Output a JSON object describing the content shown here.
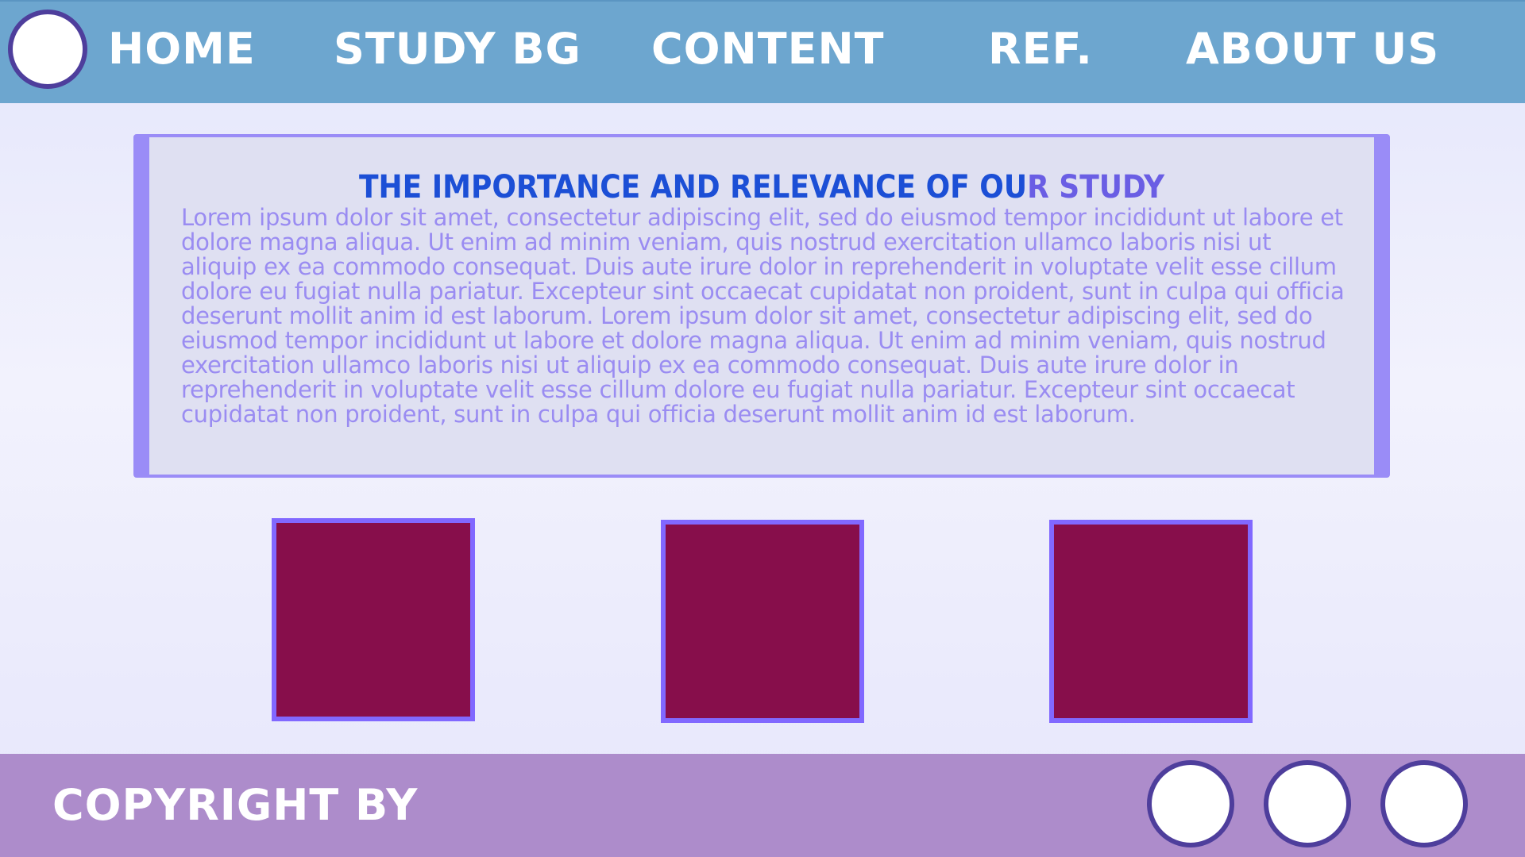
{
  "nav": {
    "items": [
      {
        "label": "HOME"
      },
      {
        "label": "STUDY BG"
      },
      {
        "label": "CONTENT"
      },
      {
        "label": "REF."
      },
      {
        "label": "ABOUT US"
      }
    ]
  },
  "main": {
    "title_part1": "THE IMPORTANCE AND RELEVANCE OF OU",
    "title_part2": "R STUDY",
    "body": "Lorem ipsum dolor sit amet, consectetur adipiscing elit, sed do eiusmod tempor incididunt ut labore et dolore magna aliqua. Ut enim ad minim veniam, quis nostrud exercitation ullamco laboris nisi ut aliquip ex ea commodo consequat. Duis aute irure dolor in reprehenderit in voluptate velit esse cillum dolore eu fugiat nulla pariatur. Excepteur sint occaecat cupidatat non proident, sunt in culpa qui officia deserunt mollit anim id est laborum. Lorem ipsum dolor sit amet, consectetur adipiscing elit, sed do eiusmod tempor incididunt ut labore et dolore magna aliqua. Ut enim ad minim veniam, quis nostrud exercitation ullamco laboris nisi ut aliquip ex ea commodo consequat. Duis aute irure dolor in reprehenderit in voluptate velit esse cillum dolore eu fugiat nulla pariatur. Excepteur sint occaecat cupidatat non proident, sunt in culpa qui officia deserunt mollit anim id est laborum."
  },
  "footer": {
    "copyright": "COPYRIGHT BY"
  },
  "colors": {
    "nav_bg": "#6da6cf",
    "footer_bg": "#ad8ccb",
    "panel_border": "#9a8cf7",
    "box_fill": "#870e4b",
    "box_border": "#8168ff",
    "title_blue": "#1c4fd6",
    "title_purple": "#6a5ee4",
    "body_text": "#9a8cf2"
  }
}
